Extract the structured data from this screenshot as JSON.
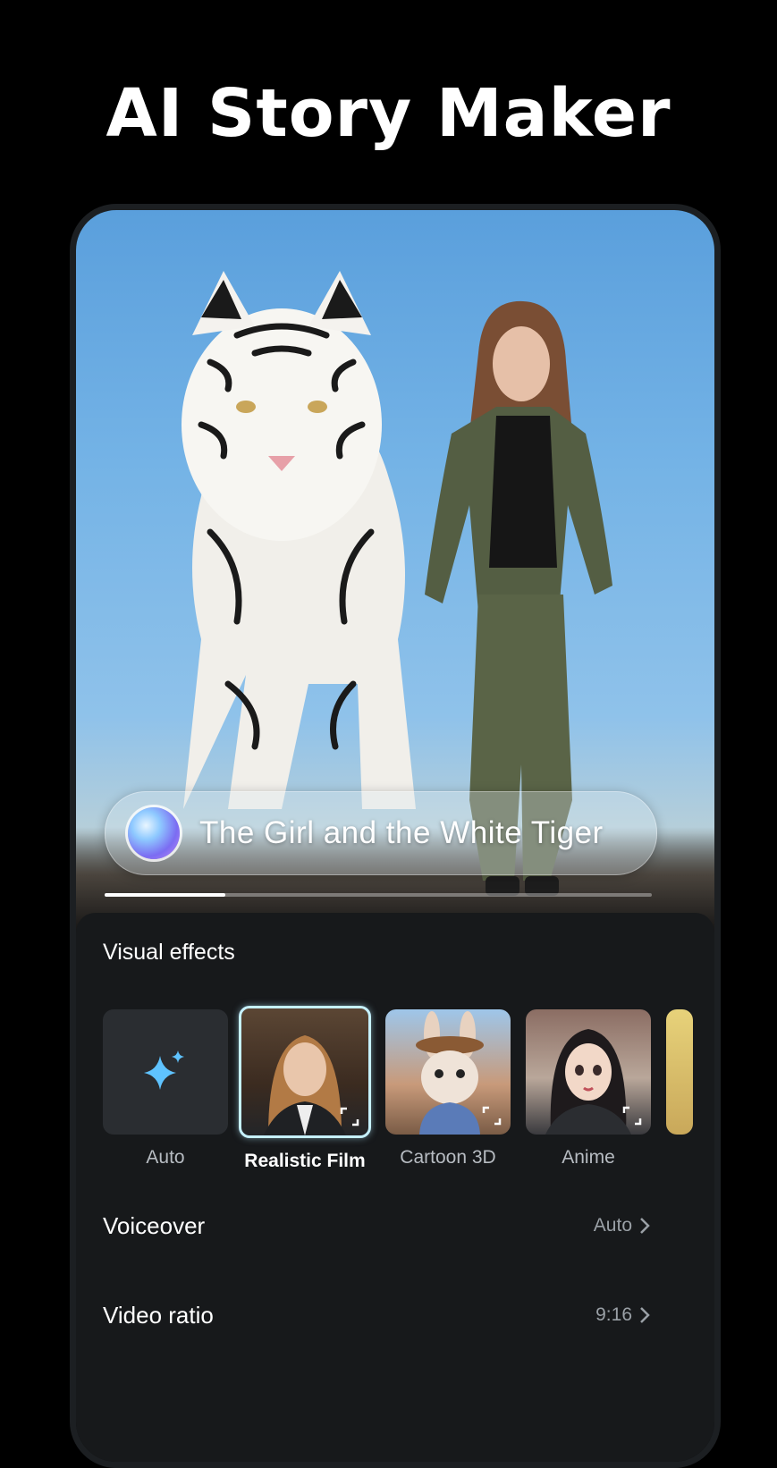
{
  "headline": "AI Story Maker",
  "hero": {
    "story_title": "The Girl and the White Tiger",
    "progress": 0.22
  },
  "visual_effects": {
    "title": "Visual effects",
    "options": [
      {
        "label": "Auto",
        "icon": "sparkle-icon",
        "selected": false
      },
      {
        "label": "Realistic Film",
        "selected": true
      },
      {
        "label": "Cartoon 3D",
        "selected": false
      },
      {
        "label": "Anime",
        "selected": false
      }
    ]
  },
  "settings": {
    "voiceover": {
      "label": "Voiceover",
      "value": "Auto",
      "icon": "chevron-right-icon"
    },
    "video_ratio": {
      "label": "Video ratio",
      "value": "9:16",
      "icon": "chevron-right-icon"
    }
  },
  "colors": {
    "accent_selected": "#c6f1ff",
    "sparkle": "#5fc3ff",
    "panel_bg": "#17191b"
  }
}
